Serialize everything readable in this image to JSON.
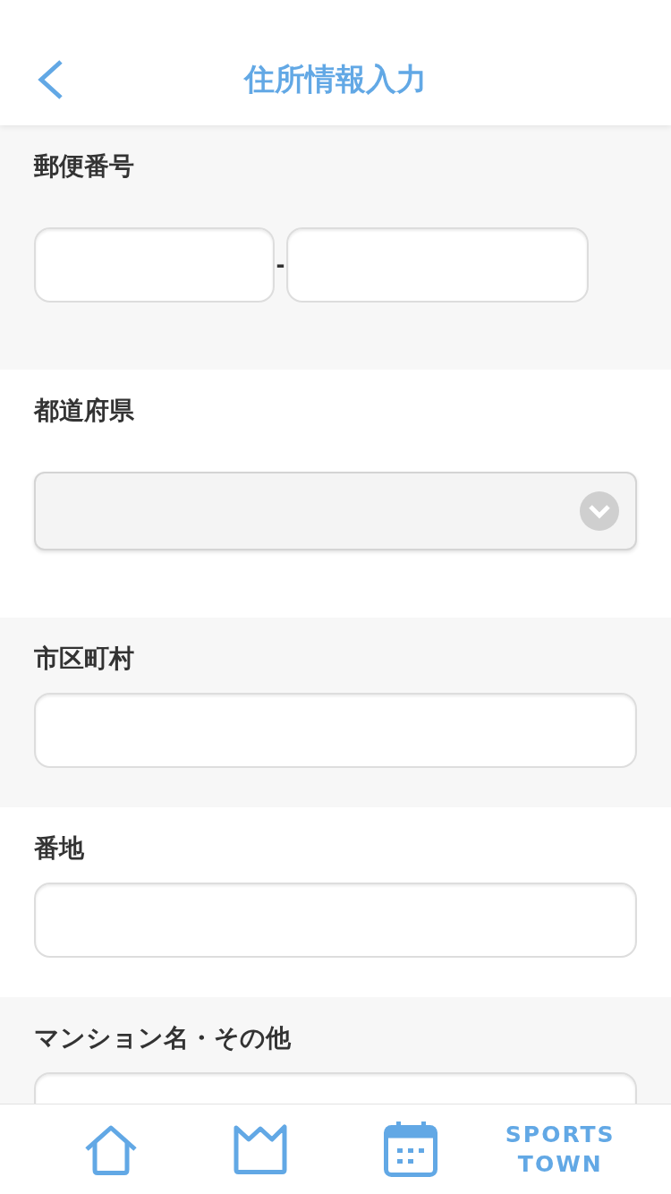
{
  "header": {
    "title": "住所情報入力"
  },
  "fields": [
    {
      "kind": "postal",
      "label": "郵便番号",
      "separator": "-"
    },
    {
      "kind": "select",
      "label": "都道府県"
    },
    {
      "kind": "text",
      "label": "市区町村"
    },
    {
      "kind": "text",
      "label": "番地"
    },
    {
      "kind": "text",
      "label": "マンション名・その他"
    }
  ],
  "tab_bar": {
    "logo": [
      "SPORTS",
      "TOWN"
    ]
  }
}
